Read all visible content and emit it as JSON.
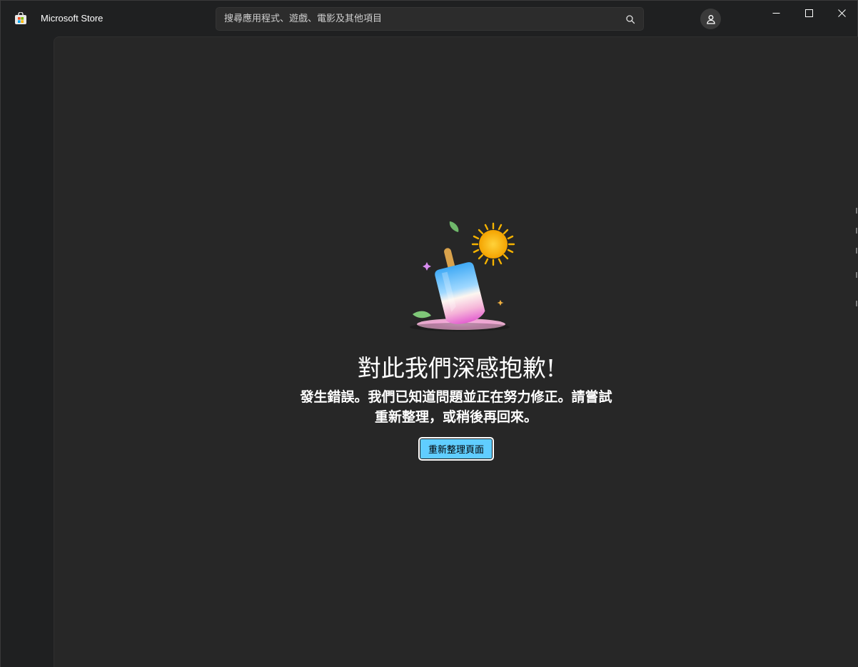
{
  "window": {
    "app_title": "Microsoft Store",
    "app_icon": "store-bag-icon"
  },
  "search": {
    "placeholder": "搜尋應用程式、遊戲、電影及其他項目",
    "value": "",
    "icon": "search-icon"
  },
  "header": {
    "account_icon": "person-icon"
  },
  "window_controls": {
    "minimize_icon": "minimize-icon",
    "maximize_icon": "maximize-icon",
    "close_icon": "close-icon"
  },
  "error_page": {
    "title": "對此我們深感抱歉!",
    "message_line1": "發生錯誤。我們已知道問題並正在努力修正。請嘗試",
    "message_line2": "重新整理，或稍後再回來。",
    "refresh_label": "重新整理頁面",
    "illustration": "melting-popsicle-illustration"
  },
  "colors": {
    "accent": "#60cdff",
    "content_background": "#272727",
    "window_background": "#1f2021"
  }
}
